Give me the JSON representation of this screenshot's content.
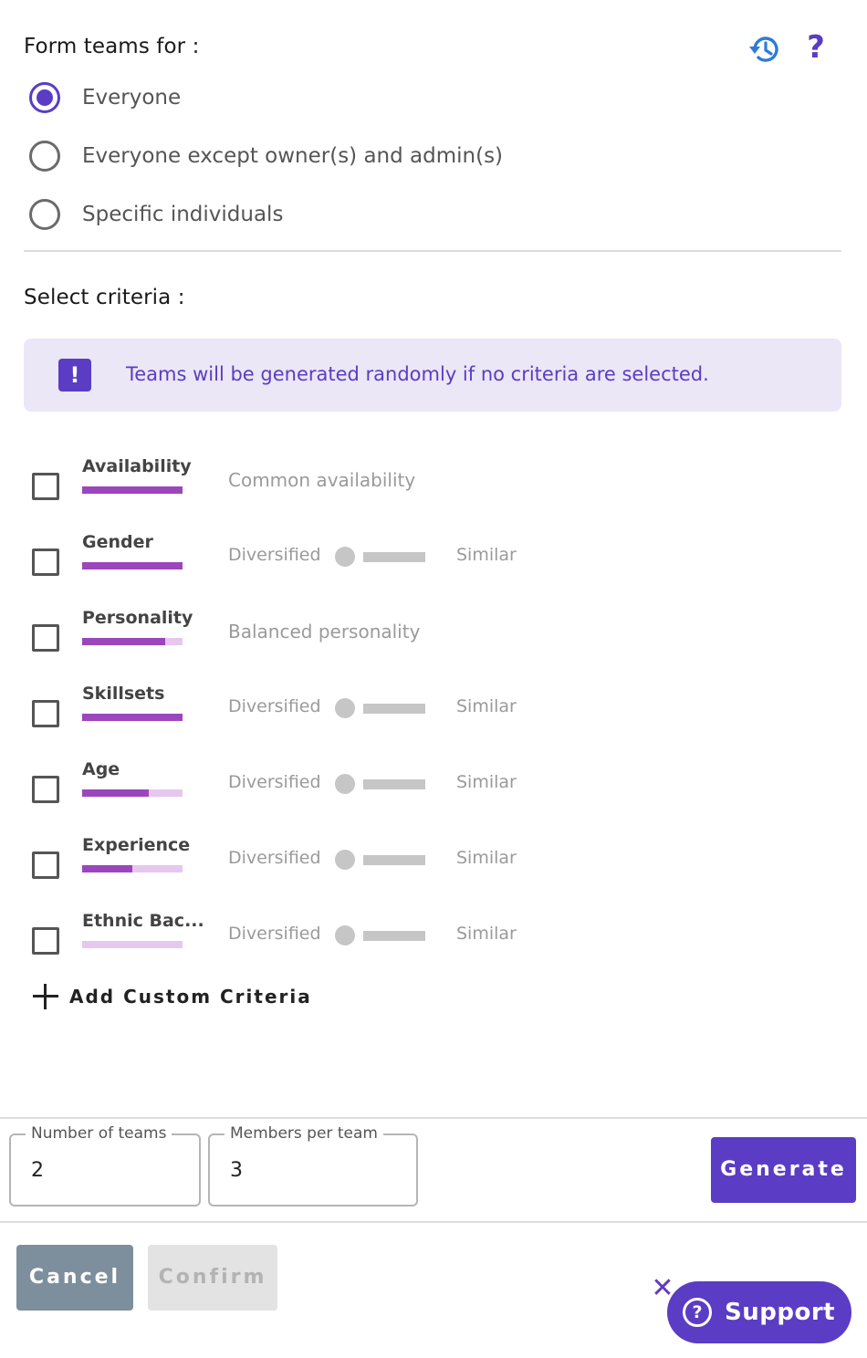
{
  "form_teams": {
    "title": "Form teams for :",
    "history_icon": "history-icon",
    "help_icon": "help-icon",
    "help_glyph": "?",
    "options": [
      {
        "label": "Everyone",
        "selected": true
      },
      {
        "label": "Everyone except owner(s) and admin(s)",
        "selected": false
      },
      {
        "label": "Specific individuals",
        "selected": false
      }
    ]
  },
  "criteria": {
    "title": "Select criteria :",
    "info_glyph": "!",
    "info_text": "Teams will be generated randomly if no criteria are selected.",
    "items": [
      {
        "name": "Availability",
        "fill": 1.0,
        "description": "Common availability"
      },
      {
        "name": "Gender",
        "fill": 1.0,
        "left_label": "Diversified",
        "right_label": "Similar"
      },
      {
        "name": "Personality",
        "fill": 0.83,
        "description": "Balanced personality"
      },
      {
        "name": "Skillsets",
        "fill": 1.0,
        "left_label": "Diversified",
        "right_label": "Similar"
      },
      {
        "name": "Age",
        "fill": 0.66,
        "left_label": "Diversified",
        "right_label": "Similar"
      },
      {
        "name": "Experience",
        "fill": 0.5,
        "left_label": "Diversified",
        "right_label": "Similar"
      },
      {
        "name": "Ethnic Bac...",
        "fill": 0.0,
        "left_label": "Diversified",
        "right_label": "Similar"
      }
    ],
    "add_custom_label": "Add Custom Criteria"
  },
  "settings": {
    "teams_label": "Number of teams",
    "teams_value": "2",
    "members_label": "Members per team",
    "members_value": "3",
    "generate_label": "Generate"
  },
  "actions": {
    "cancel_label": "Cancel",
    "confirm_label": "Confirm"
  },
  "support": {
    "close_glyph": "✕",
    "icon_glyph": "?",
    "label": "Support"
  },
  "colors": {
    "accent": "#5b3cc4",
    "bar_fill": "#9c46bd",
    "bar_track": "#e6c8ee",
    "info_bg": "#ebe7f6",
    "cancel_bg": "#7d8f9c"
  }
}
